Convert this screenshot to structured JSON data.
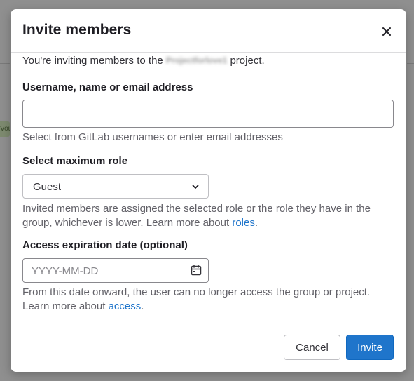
{
  "modal": {
    "title": "Invite members",
    "intro_prefix": "You're inviting members to the",
    "project_name": "Projectforlove1",
    "intro_suffix": "project."
  },
  "username_field": {
    "label": "Username, name or email address",
    "value": "",
    "help": "Select from GitLab usernames or enter email addresses"
  },
  "role_field": {
    "label": "Select maximum role",
    "selected": "Guest",
    "help_text": "Invited members are assigned the selected role or the role they have in the group, whichever is lower. Learn more about",
    "help_link": "roles",
    "help_end": "."
  },
  "expiration_field": {
    "label": "Access expiration date (optional)",
    "placeholder": "YYYY-MM-DD",
    "help_text": "From this date onward, the user can no longer access the group or project. Learn more about",
    "help_link": "access",
    "help_end": "."
  },
  "footer": {
    "cancel_label": "Cancel",
    "invite_label": "Invite"
  },
  "colors": {
    "primary": "#1f75cb",
    "link": "#1f75cb",
    "overlay": "#8f8f8f"
  },
  "background": {
    "badge_text": "Vou"
  }
}
